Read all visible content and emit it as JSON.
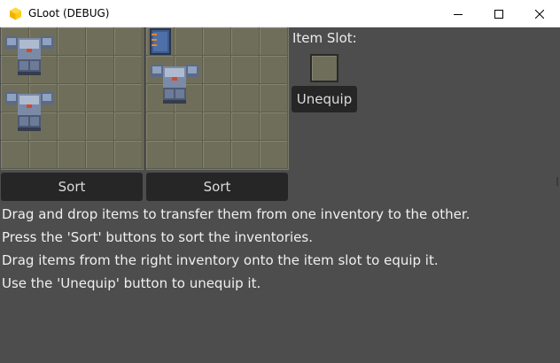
{
  "window": {
    "title": "GLoot (DEBUG)",
    "icon": "app-icon",
    "controls": [
      "minimize-icon",
      "maximize-icon",
      "close-icon"
    ]
  },
  "inventories": {
    "left": {
      "columns": 5,
      "rows": 5,
      "items": [
        {
          "type": "armor-chestplate",
          "icon": "chestplate-icon"
        },
        {
          "type": "armor-chestplate",
          "icon": "chestplate-icon"
        }
      ],
      "sort_label": "Sort"
    },
    "right": {
      "columns": 5,
      "rows": 5,
      "items": [
        {
          "type": "book",
          "icon": "book-icon"
        },
        {
          "type": "armor-chestplate",
          "icon": "chestplate-icon"
        }
      ],
      "sort_label": "Sort"
    }
  },
  "item_slot": {
    "label": "Item Slot:",
    "unequip_label": "Unequip"
  },
  "instructions": [
    "Drag and drop items to transfer them from one inventory to the other.",
    "Press the 'Sort' buttons to sort the inventories.",
    "Drag items from the right inventory onto the item slot to equip it.",
    "Use the 'Unequip' button to unequip it."
  ],
  "colors": {
    "background": "#4d4d4d",
    "inventory_cell": "#6e6e5b",
    "button": "#262626",
    "text": "#f0f0f0"
  }
}
